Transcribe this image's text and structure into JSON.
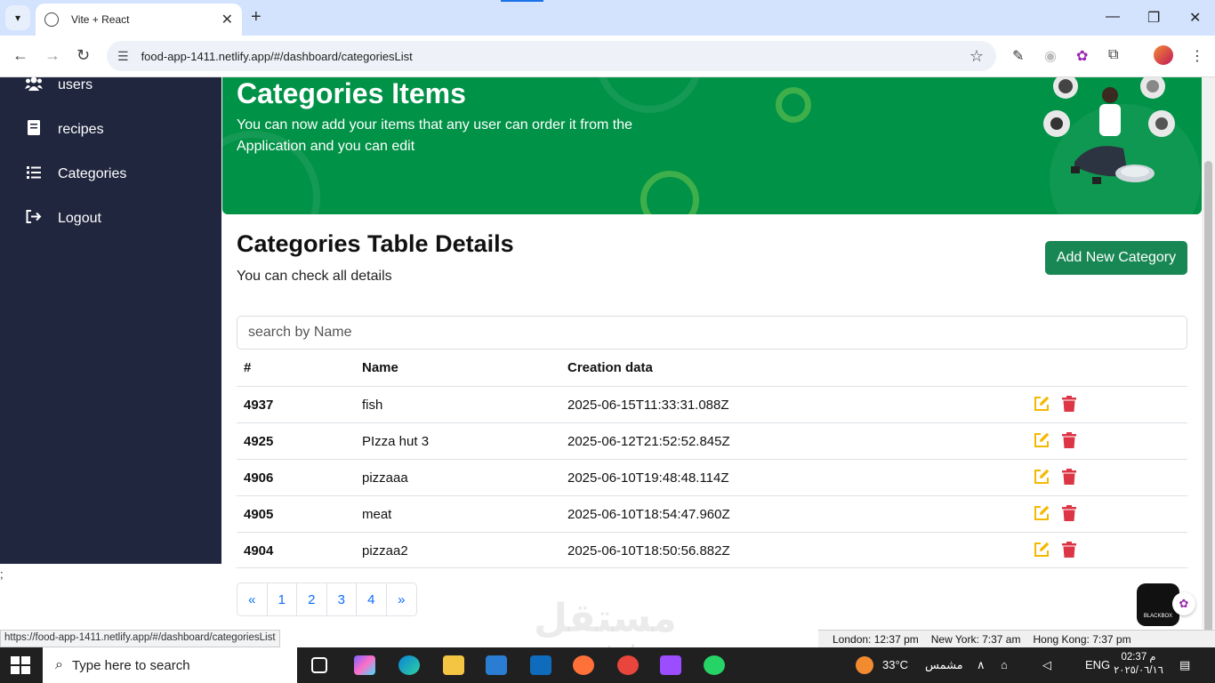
{
  "browser": {
    "tab_title": "Vite + React",
    "url": "food-app-1411.netlify.app/#/dashboard/categoriesList",
    "status_url": "https://food-app-1411.netlify.app/#/dashboard/categoriesList"
  },
  "sidebar": {
    "items": [
      {
        "label": "users",
        "icon": "users-icon"
      },
      {
        "label": "recipes",
        "icon": "recipe-icon"
      },
      {
        "label": "Categories",
        "icon": "list-icon"
      },
      {
        "label": "Logout",
        "icon": "logout-icon"
      }
    ],
    "stray_text": ";"
  },
  "header": {
    "title": "Categories Items",
    "description": "You can now add your items that any user can order it from the Application and you can edit"
  },
  "section": {
    "title": "Categories Table Details",
    "subtitle": "You can check all details",
    "add_button": "Add New Category"
  },
  "search": {
    "placeholder": "search by Name"
  },
  "table": {
    "headers": [
      "#",
      "Name",
      "Creation data"
    ],
    "rows": [
      {
        "id": "4937",
        "name": "fish",
        "date": "2025-06-15T11:33:31.088Z"
      },
      {
        "id": "4925",
        "name": "PIzza hut 3",
        "date": "2025-06-12T21:52:52.845Z"
      },
      {
        "id": "4906",
        "name": "pizzaaa",
        "date": "2025-06-10T19:48:48.114Z"
      },
      {
        "id": "4905",
        "name": "meat",
        "date": "2025-06-10T18:54:47.960Z"
      },
      {
        "id": "4904",
        "name": "pizzaa2",
        "date": "2025-06-10T18:50:56.882Z"
      }
    ]
  },
  "pagination": [
    "«",
    "1",
    "2",
    "3",
    "4",
    "»"
  ],
  "overlay": {
    "blackbox_label": "BLACKBOX",
    "watermark": "مستقل",
    "watermark_sub": "mostaql.com"
  },
  "clocks": [
    "London: 12:37 pm",
    "New York: 7:37 am",
    "Hong Kong: 7:37 pm"
  ],
  "taskbar": {
    "search_placeholder": "Type here to search",
    "weather": "33°C",
    "weather_desc": "مشمس",
    "lang": "ENG",
    "time": "02:37 م",
    "date": "٢٠٢٥/٠٦/١٦"
  },
  "colors": {
    "sidebar": "#1f263e",
    "header": "#009247",
    "primary": "#198754",
    "edit": "#f5b800",
    "delete": "#dc3545",
    "link": "#0d6efd"
  }
}
